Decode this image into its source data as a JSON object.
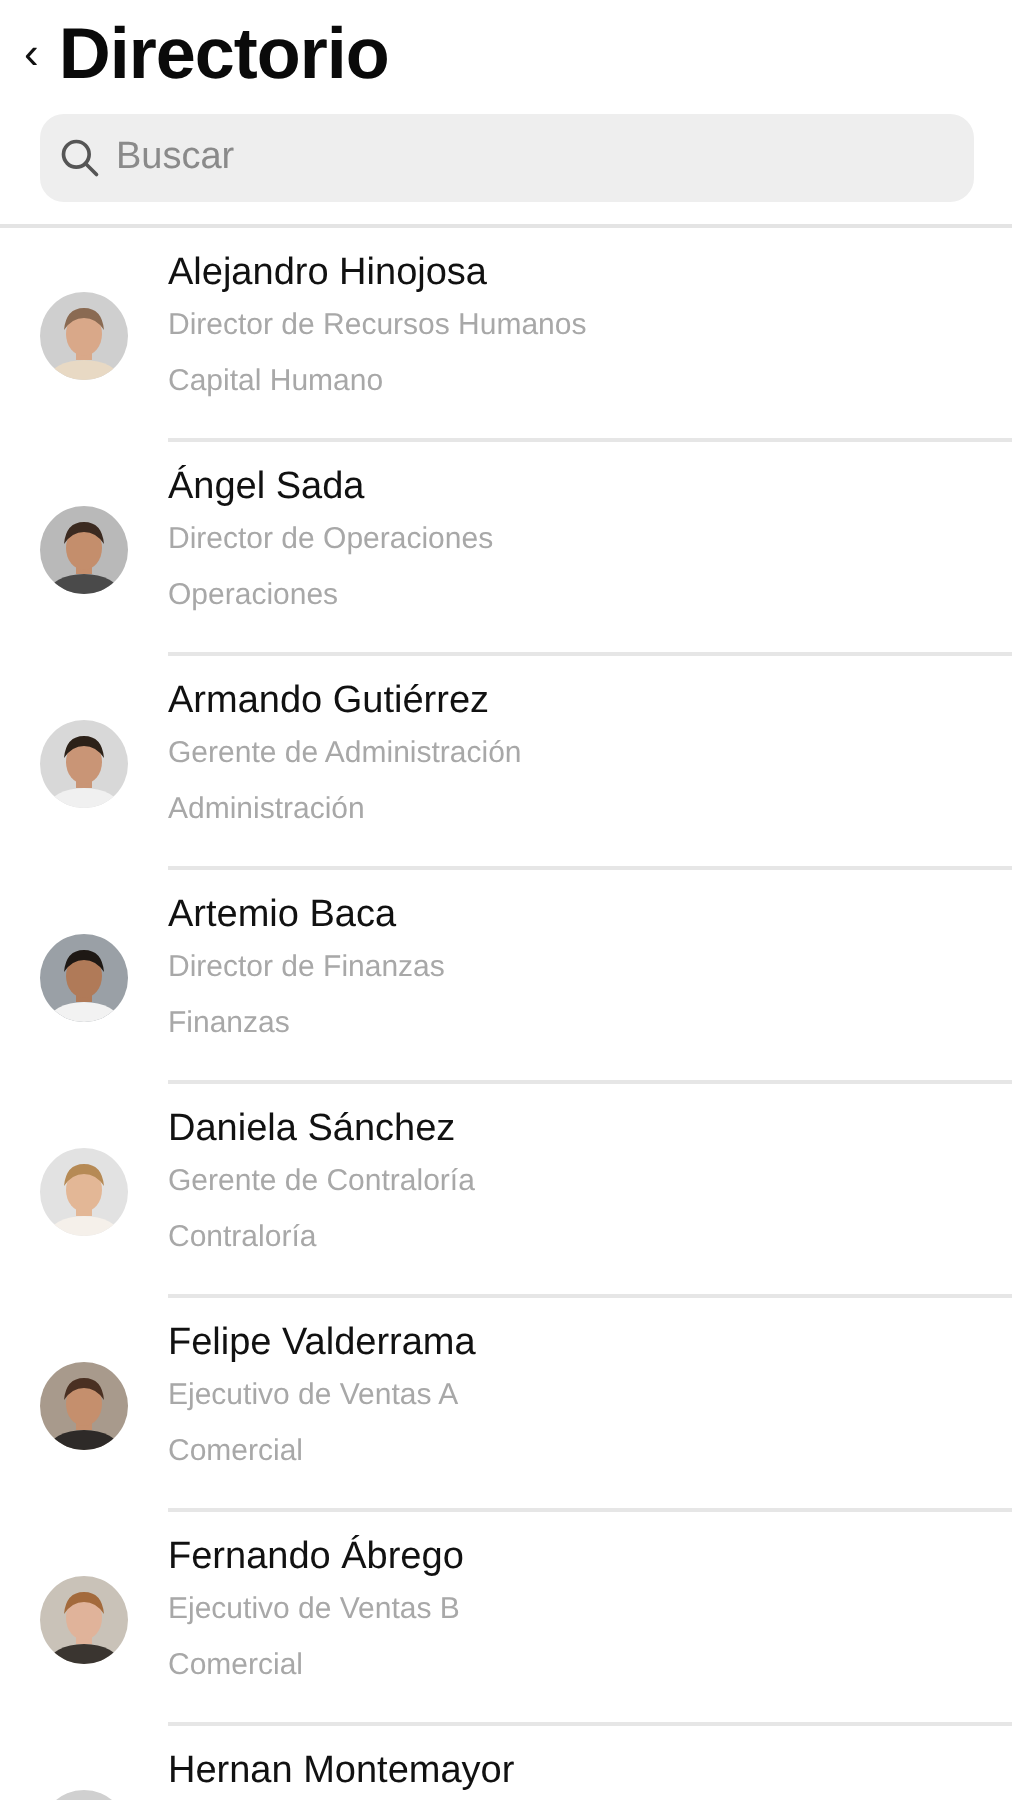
{
  "header": {
    "back": "‹",
    "title": "Directorio"
  },
  "search": {
    "placeholder": "Buscar"
  },
  "contacts": [
    {
      "name": "Alejandro Hinojosa",
      "position": "Director de Recursos Humanos",
      "department": "Capital Humano"
    },
    {
      "name": "Ángel Sada",
      "position": "Director de Operaciones",
      "department": "Operaciones"
    },
    {
      "name": "Armando Gutiérrez",
      "position": "Gerente de Administración",
      "department": "Administración"
    },
    {
      "name": "Artemio Baca",
      "position": "Director de Finanzas",
      "department": "Finanzas"
    },
    {
      "name": "Daniela Sánchez",
      "position": "Gerente de Contraloría",
      "department": "Contraloría"
    },
    {
      "name": "Felipe Valderrama",
      "position": "Ejecutivo de Ventas A",
      "department": "Comercial"
    },
    {
      "name": "Fernando Ábrego",
      "position": "Ejecutivo de Ventas B",
      "department": "Comercial"
    },
    {
      "name": "Hernan Montemayor"
    }
  ]
}
